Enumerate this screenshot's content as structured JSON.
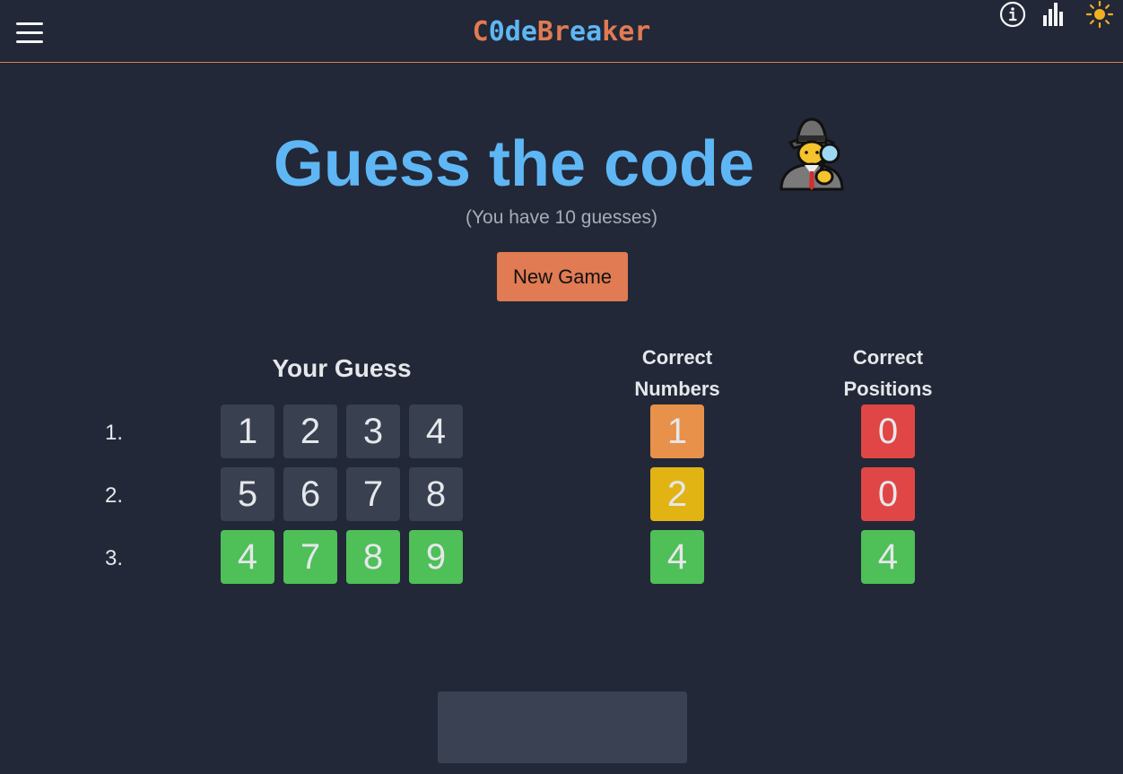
{
  "header": {
    "logo_parts": [
      {
        "text": "C",
        "color": "#e07b53"
      },
      {
        "text": "0",
        "color": "#5fb6f4"
      },
      {
        "text": "de",
        "color": "#5fb6f4"
      },
      {
        "text": "Br",
        "color": "#e07b53"
      },
      {
        "text": "ea",
        "color": "#5fb6f4"
      },
      {
        "text": "k",
        "color": "#e07b53"
      },
      {
        "text": "er",
        "color": "#e07b53"
      }
    ],
    "icons": [
      "menu-icon",
      "info-icon",
      "stats-icon",
      "sun-icon"
    ]
  },
  "title": "Guess the code",
  "title_emoji": "detective-emoji",
  "subtitle": "(You have 10 guesses)",
  "new_game_label": "New Game",
  "columns": {
    "guess": "Your Guess",
    "correct_numbers_line1": "Correct",
    "correct_numbers_line2": "Numbers",
    "correct_positions_line1": "Correct",
    "correct_positions_line2": "Positions"
  },
  "rows": [
    {
      "label": "1.",
      "digits": [
        "1",
        "2",
        "3",
        "4"
      ],
      "digit_state": "default",
      "correct_numbers": "1",
      "correct_positions": "0"
    },
    {
      "label": "2.",
      "digits": [
        "5",
        "6",
        "7",
        "8"
      ],
      "digit_state": "default",
      "correct_numbers": "2",
      "correct_positions": "0"
    },
    {
      "label": "3.",
      "digits": [
        "4",
        "7",
        "8",
        "9"
      ],
      "digit_state": "correct",
      "correct_numbers": "4",
      "correct_positions": "4"
    }
  ],
  "colors": {
    "background": "#222837",
    "accent_orange": "#e07b53",
    "title_blue": "#5fb6f4",
    "digit_default": "#394050",
    "green": "#4fbf58",
    "orange": "#e8914a",
    "yellow": "#e2b413",
    "red": "#df4645"
  }
}
